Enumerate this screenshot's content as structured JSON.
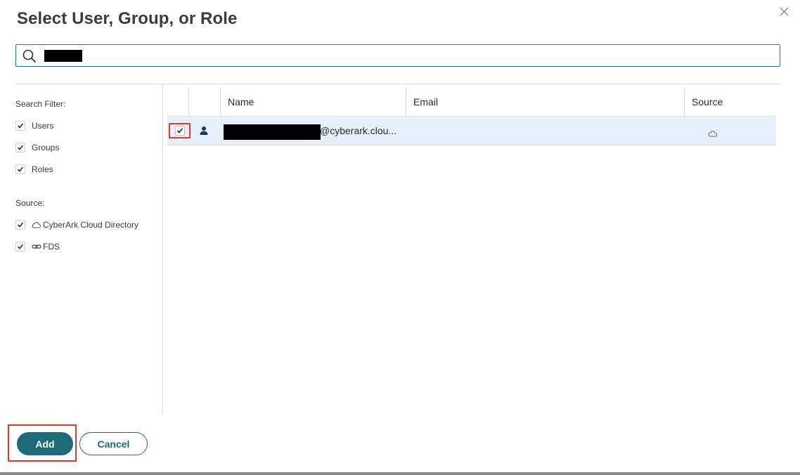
{
  "dialog": {
    "title": "Select User, Group, or Role",
    "close_icon": "close-icon"
  },
  "search": {
    "value": "",
    "icon": "search-icon"
  },
  "filters": {
    "search_filter_label": "Search Filter:",
    "types": [
      {
        "label": "Users",
        "checked": true
      },
      {
        "label": "Groups",
        "checked": true
      },
      {
        "label": "Roles",
        "checked": true
      }
    ],
    "source_label": "Source:",
    "sources": [
      {
        "label": "CyberArk Cloud Directory",
        "icon": "cloud-icon",
        "checked": true
      },
      {
        "label": "FDS",
        "icon": "link-icon",
        "checked": true
      }
    ]
  },
  "grid": {
    "columns": [
      "Name",
      "Email",
      "Source"
    ],
    "rows": [
      {
        "selected": true,
        "type_icon": "user-icon",
        "name": "@cyberark.clou...",
        "email": "",
        "source_icon": "cloud-icon"
      }
    ]
  },
  "footer": {
    "add_label": "Add",
    "cancel_label": "Cancel"
  },
  "colors": {
    "accent": "#1c6b78",
    "highlight": "#e03a2f",
    "selected_row": "#e6f0fb"
  }
}
